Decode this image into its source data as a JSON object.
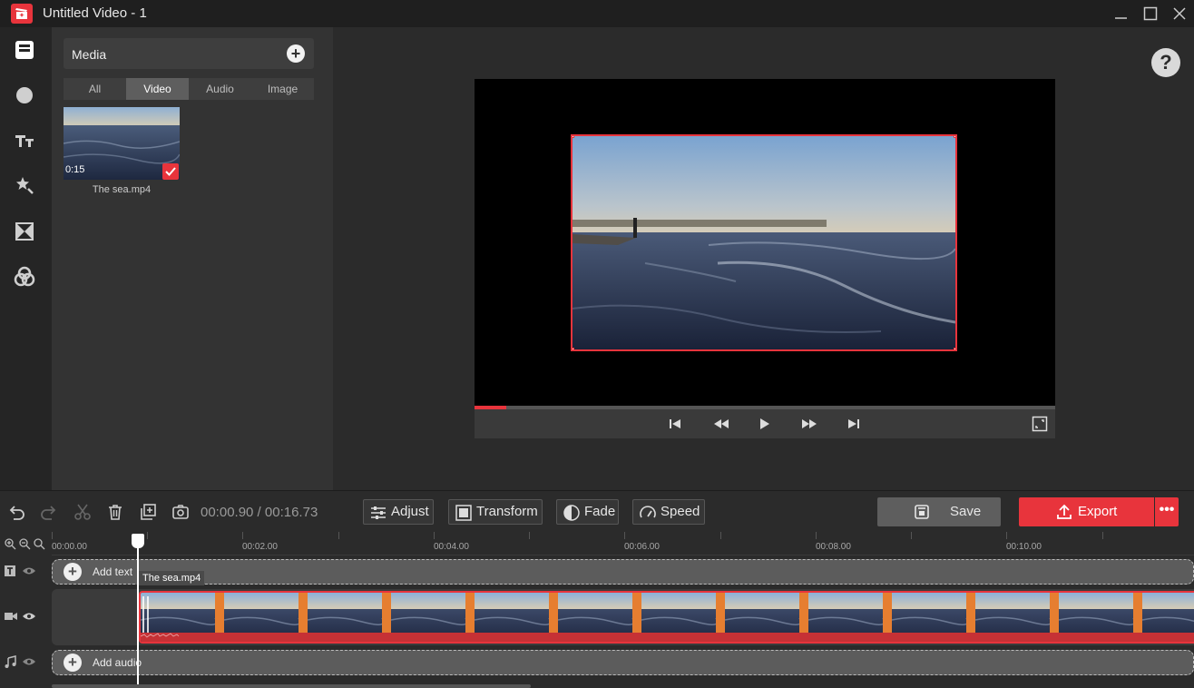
{
  "window": {
    "title": "Untitled Video - 1",
    "controls": [
      "minimize-icon",
      "maximize-icon",
      "close-icon"
    ]
  },
  "colors": {
    "accent": "#e8343c",
    "background": "#2b2b2b",
    "panel": "#333333"
  },
  "rail": {
    "items": [
      "media-icon",
      "elements-icon",
      "text-icon",
      "effects-icon",
      "transitions-icon",
      "filters-icon"
    ]
  },
  "media": {
    "title": "Media",
    "tabs": [
      "All",
      "Video",
      "Audio",
      "Image"
    ],
    "active_tab": "Video",
    "items": [
      {
        "name": "The sea.mp4",
        "duration": "0:15",
        "selected": true
      }
    ]
  },
  "preview": {
    "help": "?",
    "progress_fraction": 0.054
  },
  "toolbar": {
    "timecode": "00:00.90 / 00:16.73",
    "adjust": "Adjust",
    "transform": "Transform",
    "fade": "Fade",
    "speed": "Speed",
    "save": "Save",
    "export": "Export",
    "more": "•••"
  },
  "timeline": {
    "ruler": [
      "00:00.00",
      "00:02.00",
      "00:04.00",
      "00:06.00",
      "00:08.00",
      "00:10.00"
    ],
    "text_track_label": "Add text",
    "audio_track_label": "Add audio",
    "clip_label": "The sea.mp4",
    "playhead_time": "00:00.90"
  }
}
